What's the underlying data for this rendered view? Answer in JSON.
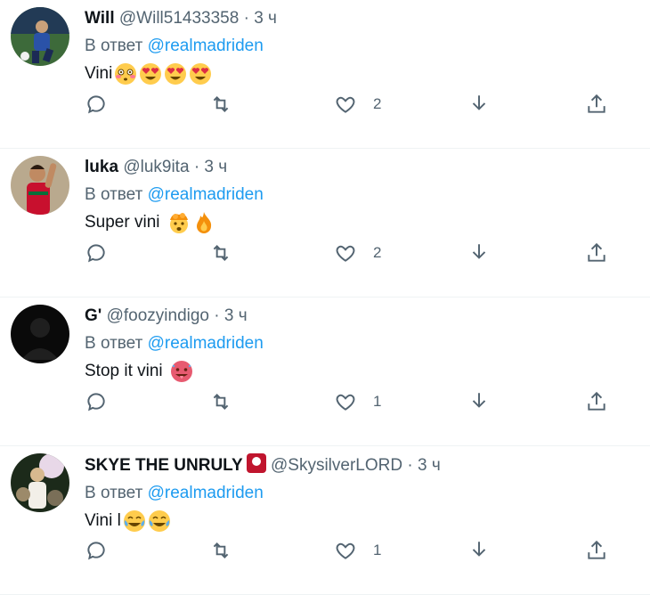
{
  "tweets": [
    {
      "name": "Will",
      "handle": "@Will51433358",
      "time": "3 ч",
      "reply_prefix": "В ответ",
      "reply_to": "@realmadriden",
      "text": "Vini",
      "emojis": [
        "flushed-face-emoji",
        "heart-eyes-emoji",
        "heart-eyes-emoji",
        "heart-eyes-emoji"
      ],
      "likes": "2",
      "avatar": "avatar-football-player"
    },
    {
      "name": "luka",
      "handle": "@luk9ita",
      "time": "3 ч",
      "reply_prefix": "В ответ",
      "reply_to": "@realmadriden",
      "text": "Super vini",
      "emojis": [
        "exploding-head-emoji",
        "fire-emoji"
      ],
      "likes": "2",
      "avatar": "avatar-red-jersey-player"
    },
    {
      "name": "G'",
      "handle": "@foozyindigo",
      "time": "3 ч",
      "reply_prefix": "В ответ",
      "reply_to": "@realmadriden",
      "text": "Stop it vini",
      "emojis": [
        "hot-face-emoji"
      ],
      "likes": "1",
      "avatar": "avatar-default-silhouette"
    },
    {
      "name": "SKYE THE UNRULY",
      "name_badge": "red-card-icon",
      "handle": "@SkysilverLORD",
      "time": "3 ч",
      "reply_prefix": "В ответ",
      "reply_to": "@realmadriden",
      "text": "Vini l",
      "emojis": [
        "tears-of-joy-emoji",
        "tears-of-joy-emoji"
      ],
      "likes": "1",
      "avatar": "avatar-celebration-photo"
    }
  ],
  "colors": {
    "link": "#1d9bf0",
    "muted": "#536471",
    "text": "#0f1419",
    "divider": "#eff3f4"
  }
}
